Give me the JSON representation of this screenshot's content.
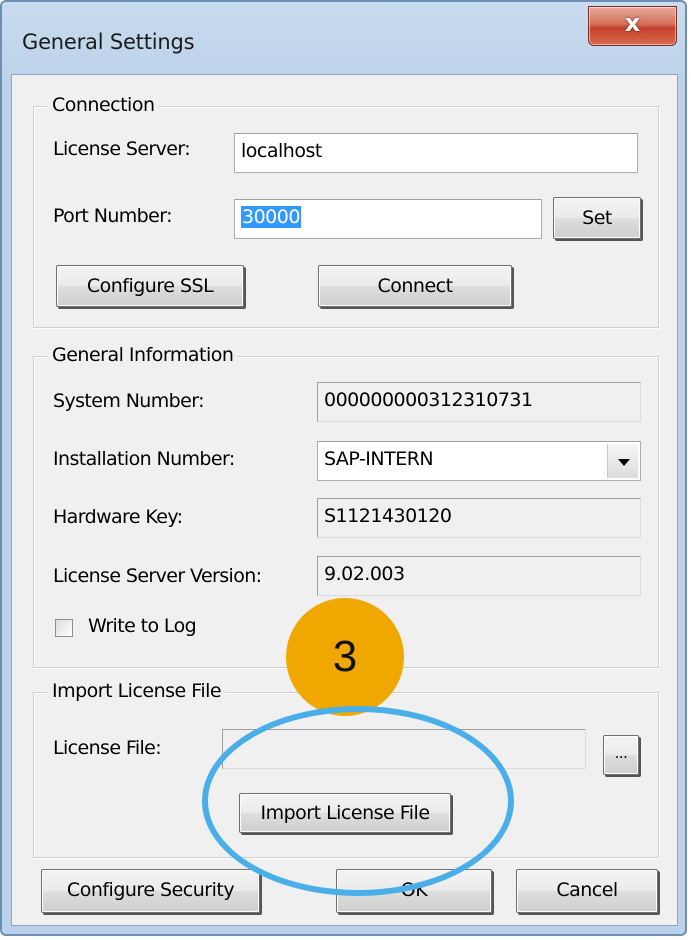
{
  "window": {
    "title": "General Settings",
    "close_label": "x"
  },
  "connection": {
    "group_title": "Connection",
    "license_server_label": "License Server:",
    "license_server_value": "localhost",
    "port_label": "Port Number:",
    "port_value": "30000",
    "set_label": "Set",
    "configure_ssl_label": "Configure SSL",
    "connect_label": "Connect"
  },
  "general_info": {
    "group_title": "General Information",
    "system_number_label": "System Number:",
    "system_number_value": "000000000312310731",
    "installation_number_label": "Installation Number:",
    "installation_number_value": "SAP-INTERN",
    "hardware_key_label": "Hardware Key:",
    "hardware_key_value": "S1121430120",
    "server_version_label": "License Server Version:",
    "server_version_value": "9.02.003",
    "write_to_log_label": "Write to Log",
    "write_to_log_checked": false
  },
  "import_license": {
    "group_title": "Import License File",
    "license_file_label": "License File:",
    "license_file_value": "",
    "browse_label": "...",
    "import_button_label": "Import License File"
  },
  "footer": {
    "configure_security_label": "Configure Security",
    "ok_label": "OK",
    "cancel_label": "Cancel"
  },
  "annotation": {
    "step_number": "3",
    "badge_color": "#f0a800",
    "highlight_color": "#4aaee8"
  }
}
